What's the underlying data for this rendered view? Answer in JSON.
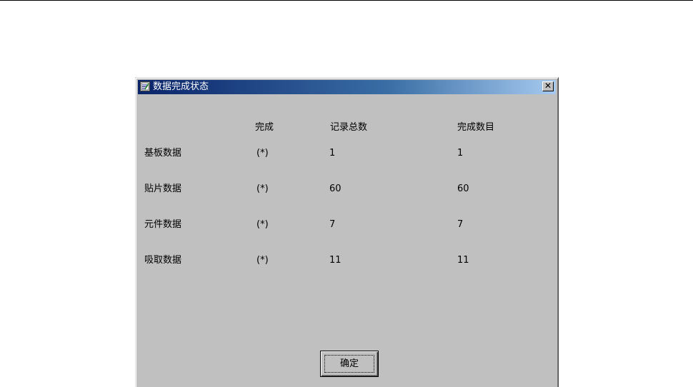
{
  "dialog": {
    "title": "数据完成状态",
    "close_label": "✕",
    "ok_label": "确定"
  },
  "table": {
    "headers": [
      "完成",
      "记录总数",
      "完成数目"
    ],
    "rows": [
      {
        "label": "基板数据",
        "done": "(*)",
        "total": "1",
        "completed": "1"
      },
      {
        "label": "贴片数据",
        "done": "(*)",
        "total": "60",
        "completed": "60"
      },
      {
        "label": "元件数据",
        "done": "(*)",
        "total": "7",
        "completed": "7"
      },
      {
        "label": "吸取数据",
        "done": "(*)",
        "total": "11",
        "completed": "11"
      }
    ]
  },
  "colors": {
    "title_bar_start": "#0a246a",
    "title_bar_end": "#a6caf0",
    "dialog_face": "#c0c0c0"
  }
}
